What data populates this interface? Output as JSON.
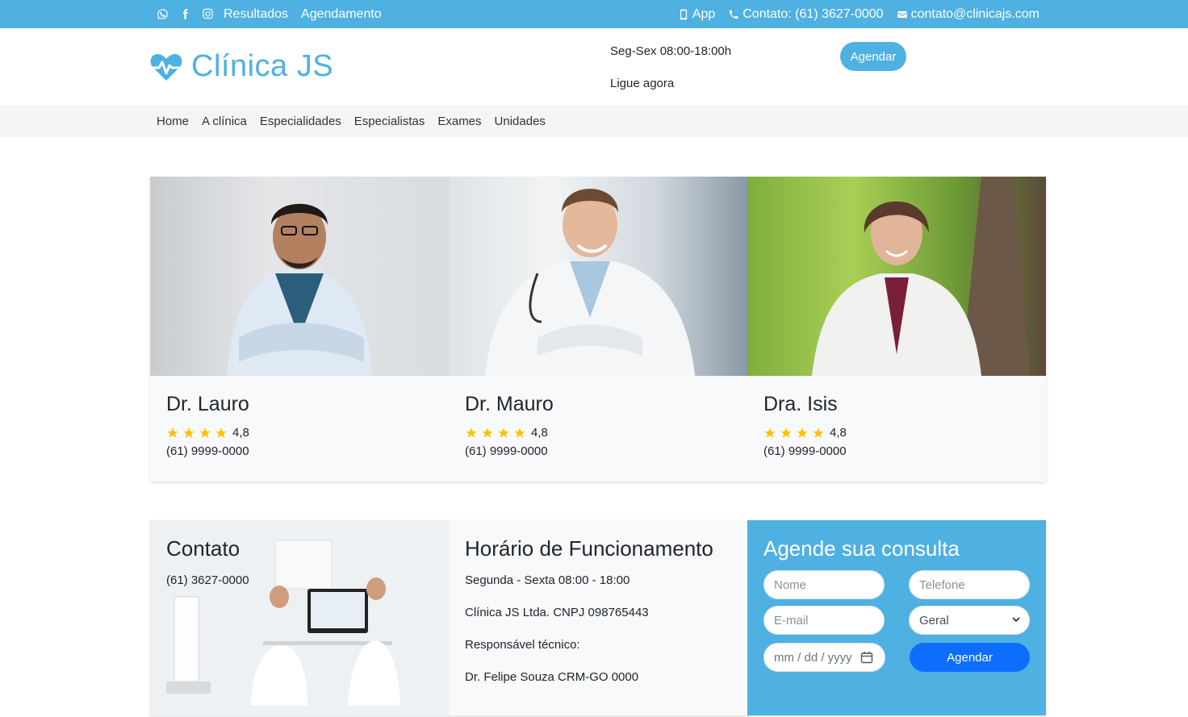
{
  "topbar": {
    "social_icons": [
      "whatsapp-icon",
      "facebook-icon",
      "instagram-icon"
    ],
    "links": [
      "Resultados",
      "Agendamento"
    ],
    "app": "App",
    "contact": "Contato: (61) 3627-0000",
    "email": "contato@clinicajs.com"
  },
  "header": {
    "brand": "Clínica JS",
    "hours": "Seg-Sex 08:00-18:00h",
    "call": "Ligue agora",
    "cta": "Agendar"
  },
  "nav": [
    "Home",
    "A clínica",
    "Especialidades",
    "Especialistas",
    "Exames",
    "Unidades"
  ],
  "doctors": [
    {
      "name": "Dr. Lauro",
      "rating": "4,8",
      "stars": 4,
      "phone": "(61) 9999-0000"
    },
    {
      "name": "Dr. Mauro",
      "rating": "4,8",
      "stars": 4,
      "phone": "(61) 9999-0000"
    },
    {
      "name": "Dra. Isis",
      "rating": "4,8",
      "stars": 4,
      "phone": "(61) 9999-0000"
    }
  ],
  "contact": {
    "title": "Contato",
    "phone": "(61) 3627-0000"
  },
  "hours_section": {
    "title": "Horário de Funcionamento",
    "lines": [
      "Segunda - Sexta 08:00 - 18:00",
      "Clínica JS Ltda. CNPJ 098765443",
      "Responsável técnico:",
      "Dr. Felipe Souza CRM-GO 0000"
    ]
  },
  "form": {
    "title": "Agende sua consulta",
    "name_placeholder": "Nome",
    "phone_placeholder": "Telefone",
    "email_placeholder": "E-mail",
    "select_value": "Geral",
    "date_placeholder": "mm / dd / yyyy",
    "submit": "Agendar"
  },
  "colors": {
    "brand": "#4fb0e2",
    "primary_button": "#0d6efd",
    "star": "#ffc107"
  }
}
